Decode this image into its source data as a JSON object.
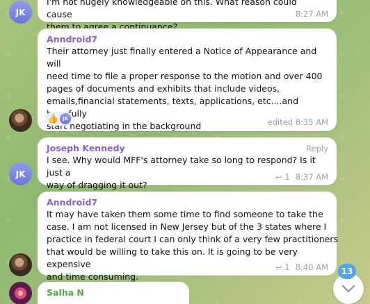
{
  "messages": [
    {
      "author": "",
      "avatar_initials": "JK",
      "text_lines": [
        "I'm not hugely knowledgeable on this. What reason could cause",
        "them to agree a continuance?"
      ],
      "time": "8:27 AM"
    },
    {
      "author": "Anndroid7",
      "text_lines": [
        "Their attorney just finally entered a Notice of Appearance and will",
        "need time to file a proper response to the motion and over 400",
        "pages of documents and exhibits that include videos,",
        "emails,financial statements, texts, applications, etc....and hopefully",
        "start negotiating in the background"
      ],
      "reaction_emoji": "👍",
      "reaction_initials": "JK",
      "time": "edited 8:35 AM"
    },
    {
      "author": "Joseph Kennedy",
      "avatar_initials": "JK",
      "reply_label": "Reply",
      "text_lines": [
        "I see. Why would MFF's attorney take so long to respond? Is it just a",
        "way of dragging it out?"
      ],
      "reply_count": "1",
      "time": "8:37 AM"
    },
    {
      "author": "Anndroid7",
      "text_lines": [
        "It may have taken them some time to find someone to take the",
        "case.  I am not licensed in New Jersey but of the 3 states where I",
        "practice in federal court I can only think of a very few practitioners",
        "that would be willing to take this on.  It is going to be very expensive",
        "and time consuming."
      ],
      "reply_count": "1",
      "time": "8:40 AM"
    },
    {
      "author": "Salha N",
      "text_lines": [
        ""
      ],
      "time": ""
    }
  ],
  "unread_count": "13",
  "icons": {
    "reply": "reply-arrow-icon",
    "scroll": "chevron-down-icon"
  }
}
